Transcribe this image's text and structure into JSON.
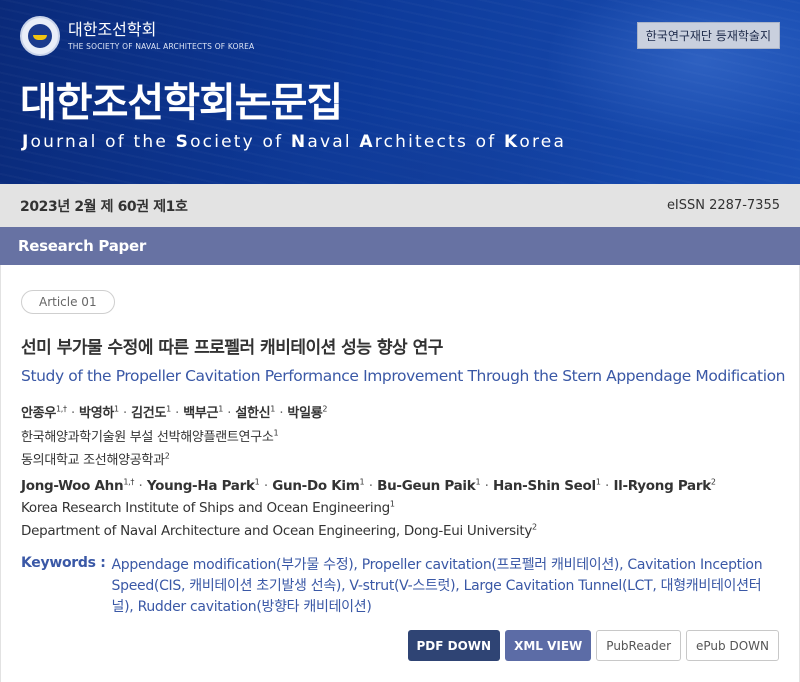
{
  "header": {
    "society_kr": "대한조선학회",
    "society_en": "THE SOCIETY OF NAVAL ARCHITECTS OF KOREA",
    "badge": "한국연구재단 등재학술지",
    "journal_kr": "대한조선학회논문집",
    "journal_en_parts": [
      {
        "cap": "J",
        "rest": "ournal of the "
      },
      {
        "cap": "S",
        "rest": "ociety of "
      },
      {
        "cap": "N",
        "rest": "aval "
      },
      {
        "cap": "A",
        "rest": "rchitects of "
      },
      {
        "cap": "K",
        "rest": "orea"
      }
    ]
  },
  "issue_bar": {
    "issue": "2023년 2월 제 60권 제1호",
    "eissn": "eISSN 2287-7355"
  },
  "section": {
    "label": "Research Paper"
  },
  "article": {
    "number": "Article 01",
    "title_kr": "선미 부가물 수정에 따른 프로펠러 캐비테이션 성능 향상 연구",
    "title_en": "Study of the Propeller Cavitation Performance Improvement Through the Stern Appendage Modification",
    "authors_kr": [
      {
        "name": "안종우",
        "sup": "1,†"
      },
      {
        "name": "박영하",
        "sup": "1"
      },
      {
        "name": "김건도",
        "sup": "1"
      },
      {
        "name": "백부근",
        "sup": "1"
      },
      {
        "name": "설한신",
        "sup": "1"
      },
      {
        "name": "박일룡",
        "sup": "2"
      }
    ],
    "affiliations_kr": [
      {
        "text": "한국해양과학기술원 부설 선박해양플랜트연구소",
        "sup": "1"
      },
      {
        "text": "동의대학교 조선해양공학과",
        "sup": "2"
      }
    ],
    "authors_en": [
      {
        "name": "Jong-Woo Ahn",
        "sup": "1,†"
      },
      {
        "name": "Young-Ha Park",
        "sup": "1"
      },
      {
        "name": "Gun-Do Kim",
        "sup": "1"
      },
      {
        "name": "Bu-Geun Paik",
        "sup": "1"
      },
      {
        "name": "Han-Shin Seol",
        "sup": "1"
      },
      {
        "name": "Il-Ryong Park",
        "sup": "2"
      }
    ],
    "affiliations_en": [
      {
        "text": "Korea Research Institute of Ships and Ocean Engineering",
        "sup": "1"
      },
      {
        "text": "Department of Naval Architecture and Ocean Engineering, Dong-Eui University",
        "sup": "2"
      }
    ],
    "separator": "·",
    "keywords_label": "Keywords :",
    "keywords": [
      "Appendage modification(부가물 수정)",
      "Propeller cavitation(프로펠러 캐비테이션)",
      "Cavitation Inception Speed(CIS, 캐비테이션 초기발생 선속)",
      "V-strut(V-스트럿)",
      "Large Cavitation Tunnel(LCT, 대형캐비테이션터널)",
      "Rudder cavitation(방향타 캐비테이션)"
    ]
  },
  "buttons": {
    "pdf": "PDF DOWN",
    "xml": "XML VIEW",
    "pubreader": "PubReader",
    "epub": "ePub DOWN"
  },
  "colors": {
    "header_bg": "#0d3a9a",
    "section_bar": "#6772a3",
    "title_en": "#3a58a6",
    "btn_pdf": "#2f4474",
    "btn_xml": "#5c6ca6"
  }
}
